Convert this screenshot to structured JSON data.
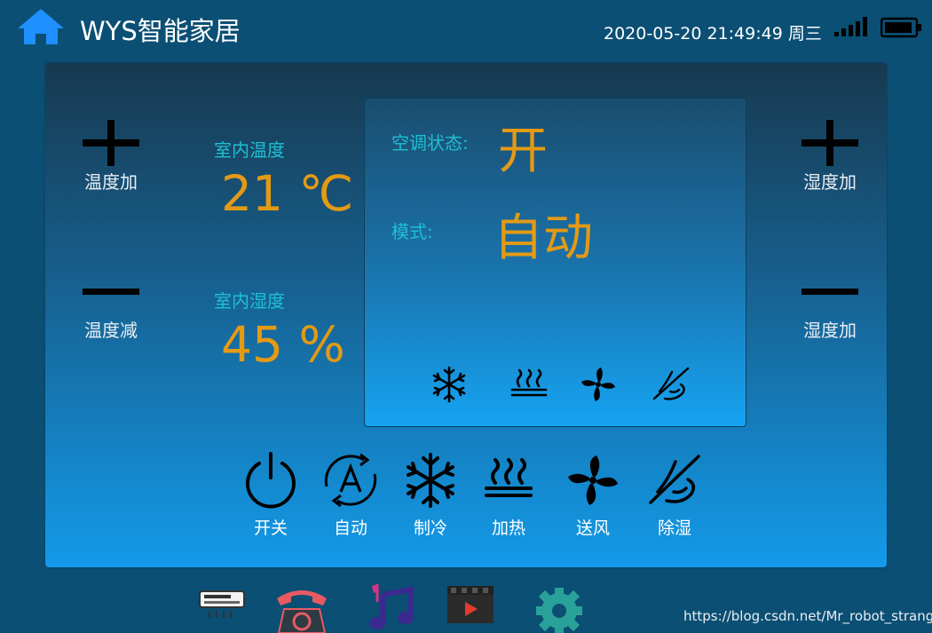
{
  "header": {
    "app_title": "WYS智能家居",
    "datetime": "2020-05-20 21:49:49 周三"
  },
  "controls": {
    "temp_up_label": "温度加",
    "temp_down_label": "温度减",
    "humidity_up_label": "湿度加",
    "humidity_down_label": "湿度加"
  },
  "readings": {
    "temperature_label": "室内温度",
    "temperature_value": "21 ℃",
    "humidity_label": "室内湿度",
    "humidity_value": "45 %"
  },
  "ac_status": {
    "state_label": "空调状态:",
    "state_value": "开",
    "mode_label": "模式:",
    "mode_value": "自动"
  },
  "mode_buttons": [
    {
      "label": "开关",
      "icon": "power-icon"
    },
    {
      "label": "自动",
      "icon": "auto-mode-icon"
    },
    {
      "label": "制冷",
      "icon": "snowflake-icon"
    },
    {
      "label": "加热",
      "icon": "heat-icon"
    },
    {
      "label": "送风",
      "icon": "fan-icon"
    },
    {
      "label": "除湿",
      "icon": "dehumidify-icon"
    }
  ],
  "dock_icons": [
    "air-conditioner-icon",
    "telephone-icon",
    "music-icon",
    "video-icon",
    "settings-gear-icon"
  ],
  "watermark": "https://blog.csdn.net/Mr_robot_strange",
  "colors": {
    "background": "#0b4f74",
    "accent_value": "#e39a14",
    "label_cyan": "#1fbfd4",
    "home_icon": "#1e90ff",
    "settings_icon": "#2aa198"
  }
}
